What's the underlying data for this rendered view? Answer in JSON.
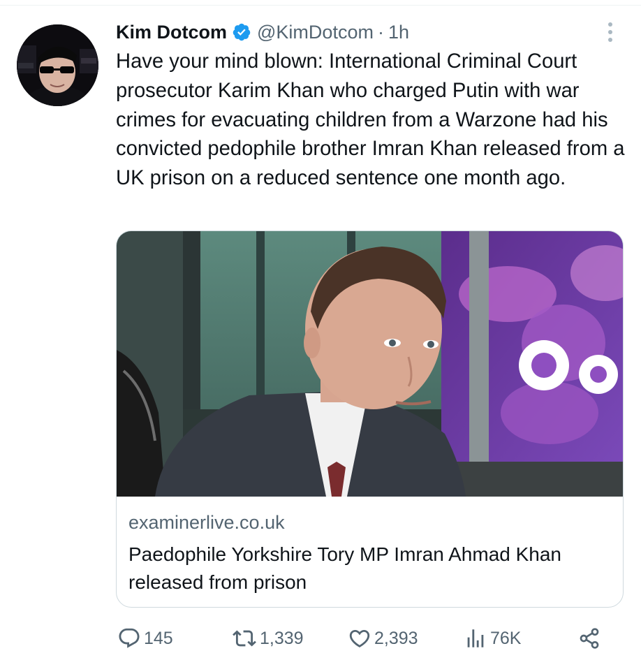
{
  "tweet": {
    "author_name": "Kim Dotcom",
    "handle": "@KimDotcom",
    "separator": "·",
    "time": "1h",
    "text": "Have your mind blown: International Criminal Court prosecutor Karim Khan who charged Putin with war crimes for evacuating children from a Warzone had his convicted pedophile brother Imran Khan released from a UK prison on a reduced sentence one month ago."
  },
  "link_card": {
    "domain": "examinerlive.co.uk",
    "title": "Paedophile Yorkshire Tory MP Imran Ahmad Khan released from prison"
  },
  "actions": {
    "replies": "145",
    "reposts": "1,339",
    "likes": "2,393",
    "views": "76K"
  },
  "icons": {
    "verified": "verified-badge-icon",
    "more": "more-vertical-icon",
    "reply": "reply-icon",
    "repost": "repost-icon",
    "like": "heart-icon",
    "views": "analytics-icon",
    "share": "share-icon"
  },
  "colors": {
    "verified_blue": "#1d9bf0",
    "secondary_text": "#536471",
    "primary_text": "#0f1419",
    "border": "#cfd9de"
  }
}
